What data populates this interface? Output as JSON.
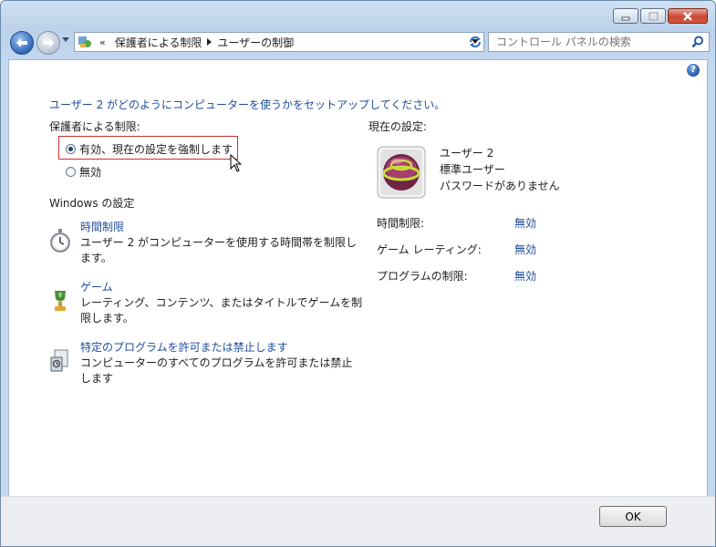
{
  "window": {
    "minimize_icon": "minimize-icon",
    "maximize_icon": "maximize-icon",
    "close_icon": "close-icon"
  },
  "address": {
    "prefix": "«",
    "crumbs": [
      "保護者による制限",
      "ユーザーの制御"
    ]
  },
  "search": {
    "placeholder": "コントロール パネルの検索"
  },
  "main": {
    "title": "ユーザー 2 がどのようにコンピューターを使うかをセットアップしてください。",
    "parental_label": "保護者による制限:",
    "options": [
      {
        "label": "有効、現在の設定を強制します",
        "selected": true
      },
      {
        "label": "無効",
        "selected": false
      }
    ],
    "windows_settings": "Windows の設定",
    "sections": [
      {
        "title": "時間制限",
        "desc": "ユーザー 2 がコンピューターを使用する時間帯を制限します。",
        "icon": "stopwatch-icon"
      },
      {
        "title": "ゲーム",
        "desc": "レーティング、コンテンツ、またはタイトルでゲームを制限します。",
        "icon": "game-trophy-icon"
      },
      {
        "title": "特定のプログラムを許可または禁止します",
        "desc": "コンピューターのすべてのプログラムを許可または禁止します",
        "icon": "programs-icon"
      }
    ]
  },
  "current": {
    "label": "現在の設定:",
    "user_name": "ユーザー 2",
    "user_type": "標準ユーザー",
    "password": "パスワードがありません",
    "rows": [
      {
        "label": "時間制限:",
        "value": "無効"
      },
      {
        "label": "ゲーム レーティング:",
        "value": "無効"
      },
      {
        "label": "プログラムの制限:",
        "value": "無効"
      }
    ]
  },
  "buttons": {
    "ok": "OK"
  }
}
